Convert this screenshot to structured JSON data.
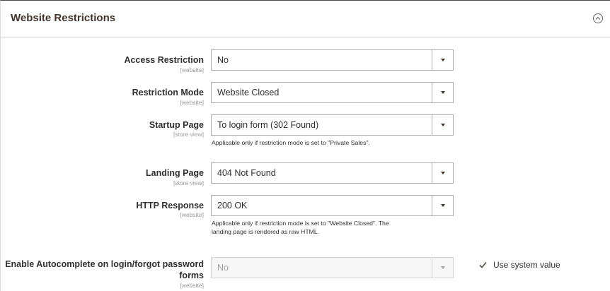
{
  "section": {
    "title": "Website Restrictions"
  },
  "fields": {
    "access_restriction": {
      "label": "Access Restriction",
      "scope": "[website]",
      "value": "No"
    },
    "restriction_mode": {
      "label": "Restriction Mode",
      "scope": "[website]",
      "value": "Website Closed"
    },
    "startup_page": {
      "label": "Startup Page",
      "scope": "[store view]",
      "value": "To login form (302 Found)",
      "note": "Applicable only if restriction mode is set to \"Private Sales\"."
    },
    "landing_page": {
      "label": "Landing Page",
      "scope": "[store view]",
      "value": "404 Not Found"
    },
    "http_response": {
      "label": "HTTP Response",
      "scope": "[website]",
      "value": "200 OK",
      "note_line1": "Applicable only if restriction mode is set to \"Website Closed\". The",
      "note_line2": "landing page is rendered as raw HTML."
    },
    "autocomplete": {
      "label_line1": "Enable Autocomplete on login/forgot password",
      "label_line2": "forms",
      "scope": "[website]",
      "value": "No",
      "disabled": true,
      "use_system_value": {
        "label": "Use system value",
        "checked": true
      }
    }
  },
  "icons": {
    "collapse": "chevron-up-circle-icon",
    "dropdown": "caret-down-icon",
    "check": "checkmark-icon"
  },
  "colors": {
    "title": "#41362f",
    "border": "#adadad",
    "scope_text": "#999999",
    "disabled_text": "#a5a5a5"
  }
}
